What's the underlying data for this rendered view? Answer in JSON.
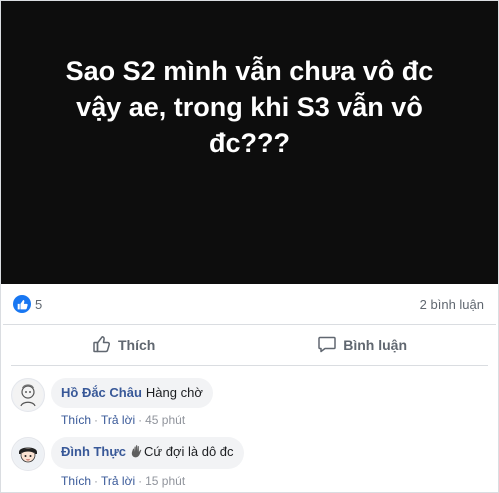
{
  "post": {
    "text": "Sao S2 mình vẫn chưa vô đc vậy ae, trong khi S3 vẫn vô đc???"
  },
  "stats": {
    "reaction_count": "5",
    "comment_count": "2 bình luận"
  },
  "actions": {
    "like_label": "Thích",
    "comment_label": "Bình luận"
  },
  "comments": [
    {
      "author": "Hồ Đắc Châu",
      "text": "Hàng chờ",
      "like": "Thích",
      "reply": "Trả lời",
      "time": "45 phút"
    },
    {
      "author": "Đình Thực",
      "text_after_icon": "Cứ đợi là dô đc",
      "icon": "wave-hand-icon",
      "like": "Thích",
      "reply": "Trả lời",
      "time": "15 phút"
    }
  ],
  "colors": {
    "banner": "#0d0d0d",
    "like_blue": "#1877f2",
    "author_blue": "#385898"
  }
}
